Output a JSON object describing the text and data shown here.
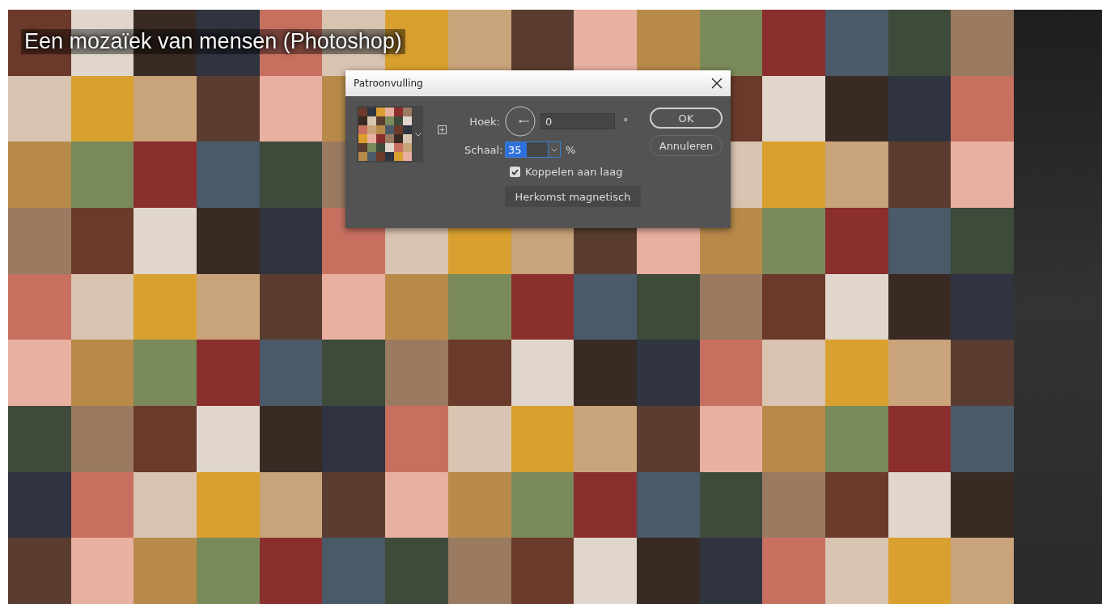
{
  "video": {
    "title": "Een mozaïek van mensen (Photoshop)"
  },
  "dialog": {
    "title": "Patroonvulling",
    "angle": {
      "label": "Hoek:",
      "value": "0",
      "unit": "°"
    },
    "scale": {
      "label": "Schaal:",
      "value": "35",
      "value_selected": true,
      "unit": "%"
    },
    "link_layer": {
      "label": "Koppelen aan laag",
      "checked": true
    },
    "snap_button": "Herkomst magnetisch",
    "buttons": [
      {
        "label": "OK",
        "kind": "default"
      },
      {
        "label": "Annuleren",
        "kind": "normal"
      }
    ]
  }
}
